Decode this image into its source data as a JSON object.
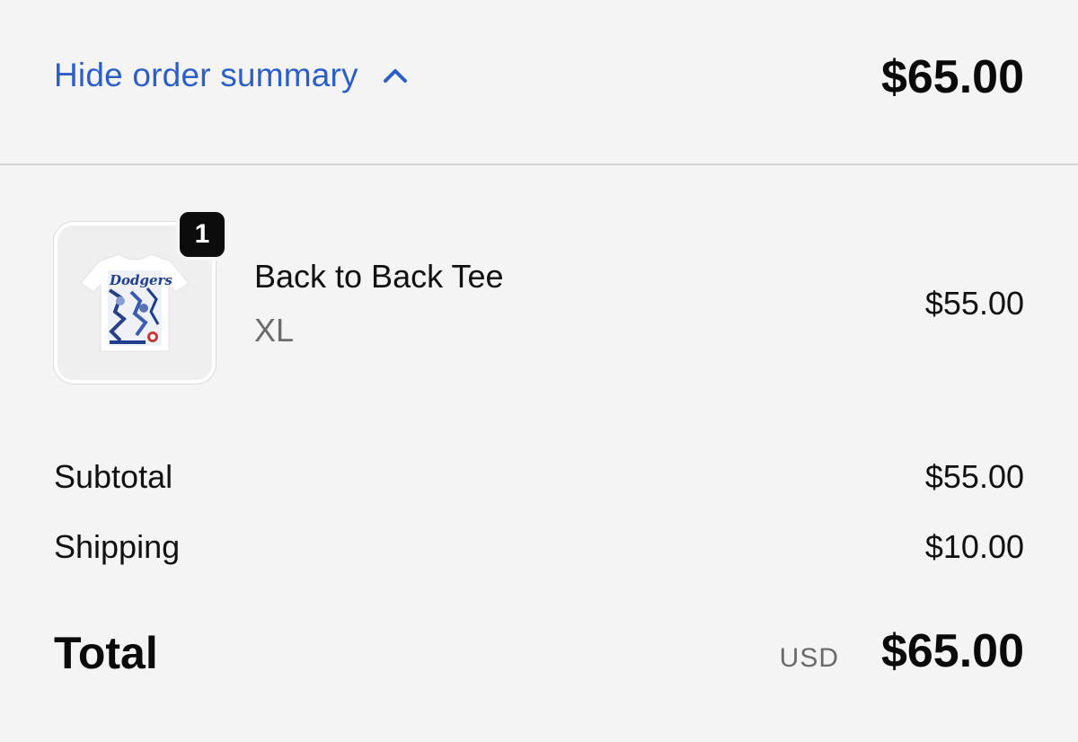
{
  "header": {
    "toggle_label": "Hide order summary",
    "total": "$65.00"
  },
  "line_items": [
    {
      "quantity": "1",
      "name": "Back to Back Tee",
      "variant": "XL",
      "price": "$55.00"
    }
  ],
  "totals": {
    "subtotal_label": "Subtotal",
    "subtotal_value": "$55.00",
    "shipping_label": "Shipping",
    "shipping_value": "$10.00",
    "total_label": "Total",
    "currency": "USD",
    "total_value": "$65.00"
  },
  "icons": {
    "toggle": "chevron-up-icon"
  },
  "colors": {
    "link": "#2b5fc7",
    "background": "#f4f4f4",
    "badge": "#0c0c0c"
  }
}
